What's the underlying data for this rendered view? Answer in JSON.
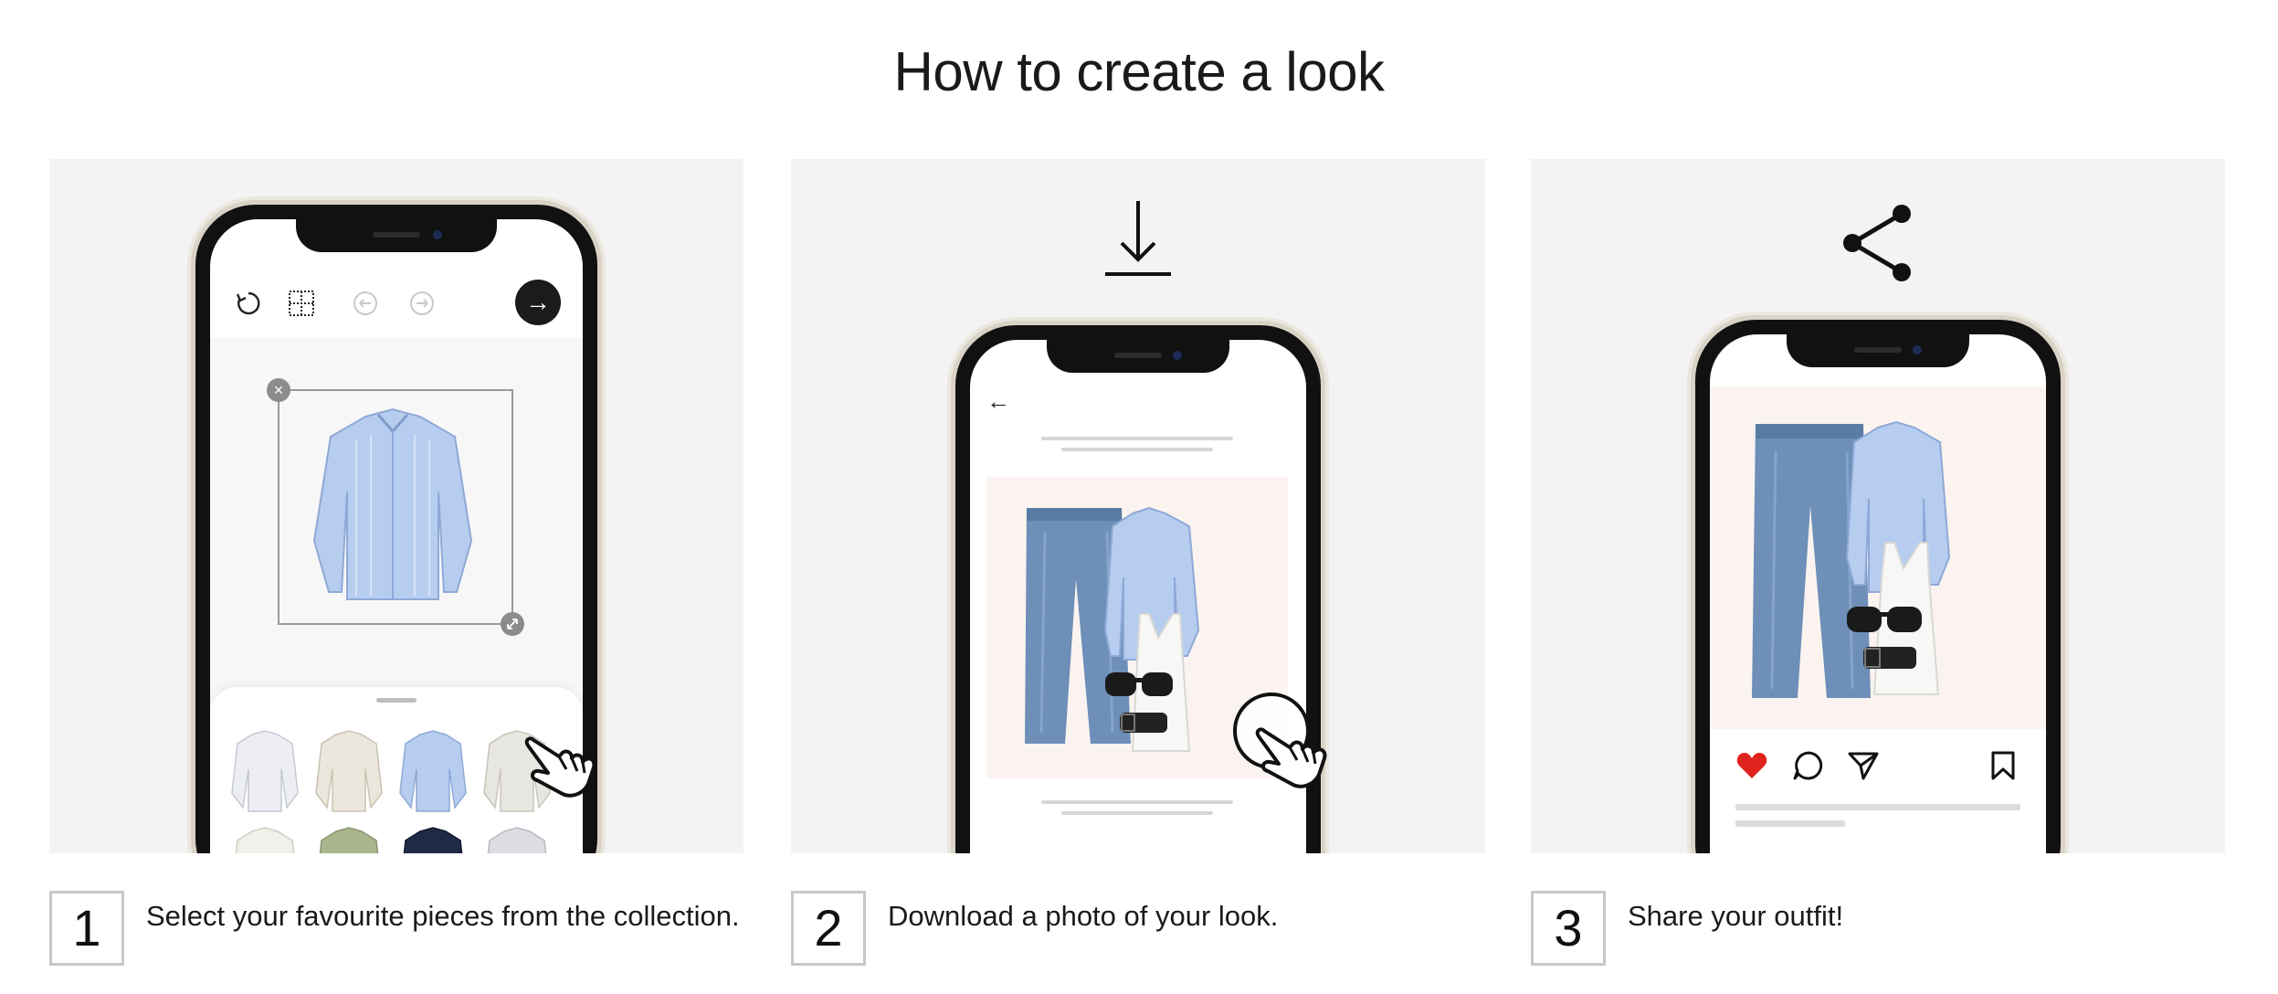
{
  "page": {
    "title": "How to create a look"
  },
  "steps": [
    {
      "number": "1",
      "text": "Select your favourite pieces from the collection."
    },
    {
      "number": "2",
      "text": "Download a photo of your look."
    },
    {
      "number": "3",
      "text": "Share your outfit!"
    }
  ],
  "icons": {
    "download": "download-icon",
    "share": "share-icon",
    "back": "←",
    "next": "→",
    "like_color": "#e0231c"
  },
  "colors": {
    "panel_bg": "#f3f3f3",
    "look_bg": "#fbf3ef",
    "shirt_blue": "#a9c3ec",
    "denim": "#6d8fb8"
  }
}
